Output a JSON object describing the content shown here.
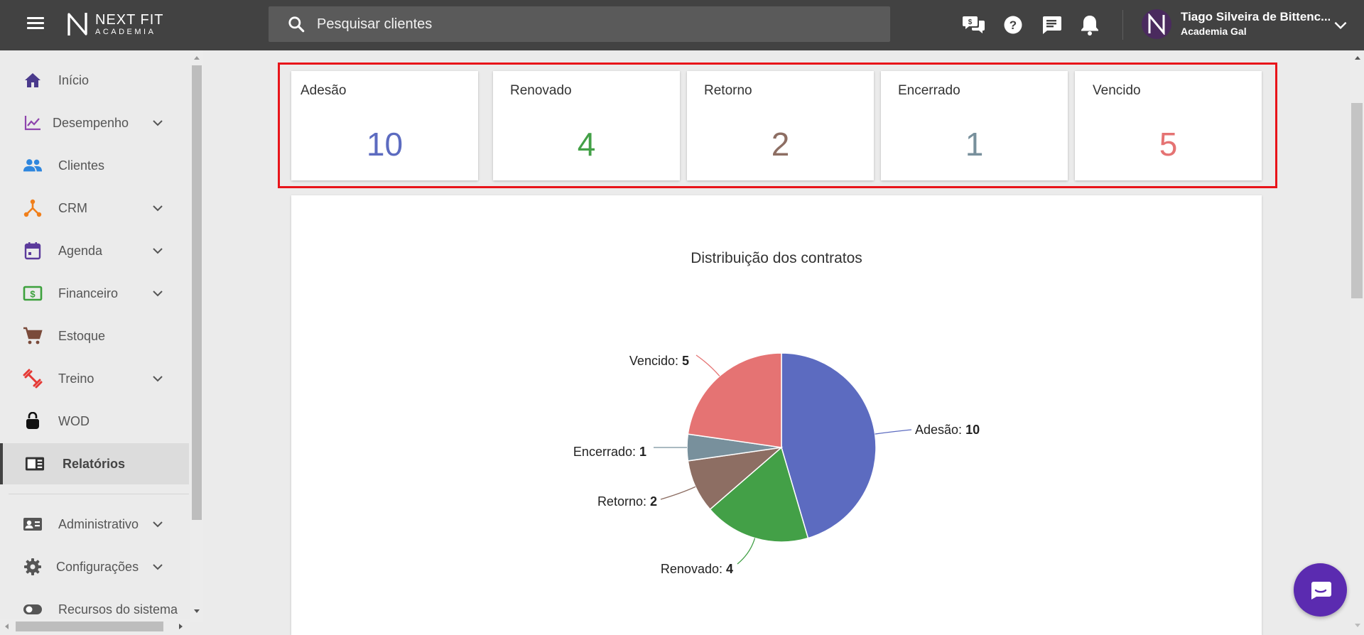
{
  "header": {
    "logo": {
      "line1": "NEXT FIT",
      "line2": "ACADEMIA"
    },
    "search_placeholder": "Pesquisar clientes",
    "user": {
      "name": "Tiago Silveira de Bittenc...",
      "org": "Academia Gal"
    }
  },
  "sidebar": {
    "items": [
      {
        "label": "Início",
        "icon": "home-icon",
        "color": "#4a3a8c"
      },
      {
        "label": "Desempenho",
        "icon": "chart-line-icon",
        "color": "#8e44ad"
      },
      {
        "label": "Clientes",
        "icon": "people-icon",
        "color": "#2e86de"
      },
      {
        "label": "CRM",
        "icon": "crm-hub-icon",
        "color": "#f07f1a"
      },
      {
        "label": "Agenda",
        "icon": "calendar-icon",
        "color": "#5b3a9b"
      },
      {
        "label": "Financeiro",
        "icon": "money-icon",
        "color": "#3da13d"
      },
      {
        "label": "Estoque",
        "icon": "cart-icon",
        "color": "#7a4a3a"
      },
      {
        "label": "Treino",
        "icon": "dumbbell-icon",
        "color": "#e53935"
      },
      {
        "label": "WOD",
        "icon": "kettlebell-icon",
        "color": "#111111"
      },
      {
        "label": "Relatórios",
        "icon": "report-icon",
        "color": "#333333"
      },
      {
        "label": "Administrativo",
        "icon": "id-card-icon",
        "color": "#555555"
      },
      {
        "label": "Configurações",
        "icon": "gear-icon",
        "color": "#555555"
      },
      {
        "label": "Recursos do sistema",
        "icon": "toggle-icon",
        "color": "#555555"
      }
    ]
  },
  "stats": [
    {
      "label": "Adesão",
      "value": "10",
      "color": "#5c6bc0"
    },
    {
      "label": "Renovado",
      "value": "4",
      "color": "#43a047"
    },
    {
      "label": "Retorno",
      "value": "2",
      "color": "#8d6e63"
    },
    {
      "label": "Encerrado",
      "value": "1",
      "color": "#78909c"
    },
    {
      "label": "Vencido",
      "value": "5",
      "color": "#e57373"
    }
  ],
  "chart_data": {
    "type": "pie",
    "title": "Distribuição dos contratos",
    "categories": [
      "Adesão",
      "Renovado",
      "Retorno",
      "Encerrado",
      "Vencido"
    ],
    "values": [
      10,
      4,
      2,
      1,
      5
    ],
    "colors": [
      "#5c6bc0",
      "#43a047",
      "#8d6e63",
      "#78909c",
      "#e57373"
    ],
    "data_labels": [
      "Adesão: 10",
      "Renovado: 4",
      "Retorno: 2",
      "Encerrado: 1",
      "Vencido: 5"
    ]
  }
}
